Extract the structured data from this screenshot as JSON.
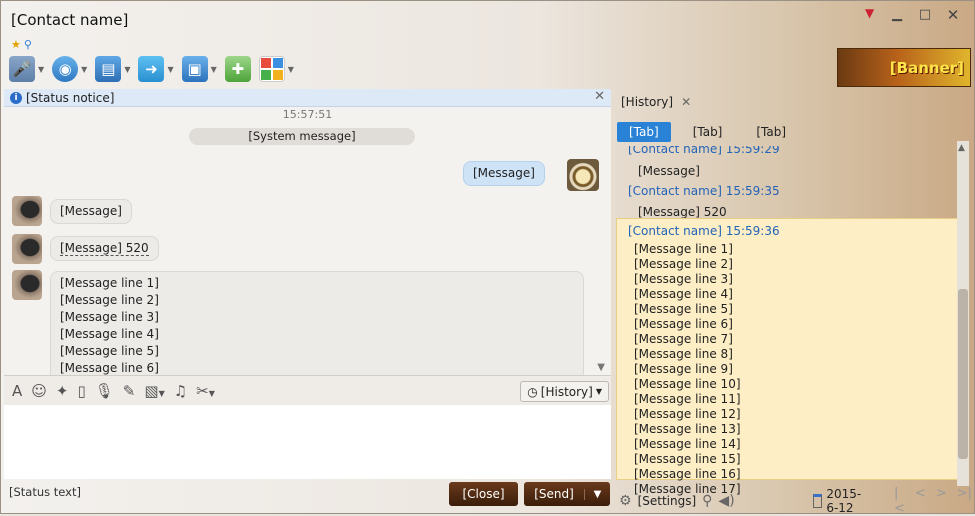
{
  "window": {
    "title": "[Contact name]",
    "controls": {
      "minimize": "▁",
      "maximize": "□",
      "close": "✕",
      "pin": "▼"
    }
  },
  "toolbar": {
    "items": [
      {
        "icon": "mic-icon",
        "glyph": "🎤"
      },
      {
        "icon": "camera-icon",
        "glyph": "◉"
      },
      {
        "icon": "screen-share-icon",
        "glyph": "▤"
      },
      {
        "icon": "file-transfer-icon",
        "glyph": "➜"
      },
      {
        "icon": "remote-desktop-icon",
        "glyph": "▣"
      },
      {
        "icon": "invite-icon",
        "glyph": "✚"
      },
      {
        "icon": "apps-icon",
        "glyph": ""
      }
    ],
    "banner": "[Banner]"
  },
  "infobar": {
    "text": "[Status notice]",
    "close": "✕"
  },
  "chat": {
    "timestamp": "15:57:51",
    "system_message": "[System message]",
    "messages": [
      {
        "from": "me",
        "text": "[Message]"
      },
      {
        "from": "them",
        "text": "[Message]"
      },
      {
        "from": "them",
        "text": "[Message] 520"
      },
      {
        "from": "them",
        "lines": [
          "[Message line 1]",
          "[Message line 2]",
          "[Message line 3]",
          "[Message line 4]",
          "[Message line 5]",
          "[Message line 6]"
        ]
      }
    ]
  },
  "input_toolbar": {
    "history_label": "[History]"
  },
  "footer": {
    "status_text": "[Status text]",
    "close_button": "[Close]",
    "send_button": "[Send]",
    "send_dropdown": "▼"
  },
  "history_panel": {
    "tab_label": "[History]",
    "tab_close": "✕",
    "filters": [
      "[Tab]",
      "[Tab]",
      "[Tab]"
    ],
    "records": [
      {
        "header": "[Contact name] 15:59:29",
        "body": "[Message]"
      },
      {
        "header": "[Contact name] 15:59:35",
        "body": "[Message] 520"
      },
      {
        "header": "[Contact name] 15:59:36",
        "body_lines": [
          "[Message line 1]",
          "[Message line 2]",
          "[Message line 3]",
          "[Message line 4]",
          "[Message line 5]",
          "[Message line 6]",
          "[Message line 7]",
          "[Message line 8]",
          "[Message line 9]",
          "[Message line 10]",
          "[Message line 11]",
          "[Message line 12]",
          "[Message line 13]",
          "[Message line 14]",
          "[Message line 15]",
          "[Message line 16]",
          "[Message line 17]"
        ]
      }
    ],
    "bottom": {
      "settings_label": "[Settings]",
      "date": "2015-6-12",
      "nav": [
        "|<",
        "<",
        ">",
        ">|"
      ]
    }
  },
  "colors": {
    "accent": "#2a82d7",
    "send_button": "#4a2712",
    "highlight": "#fdeec5"
  }
}
